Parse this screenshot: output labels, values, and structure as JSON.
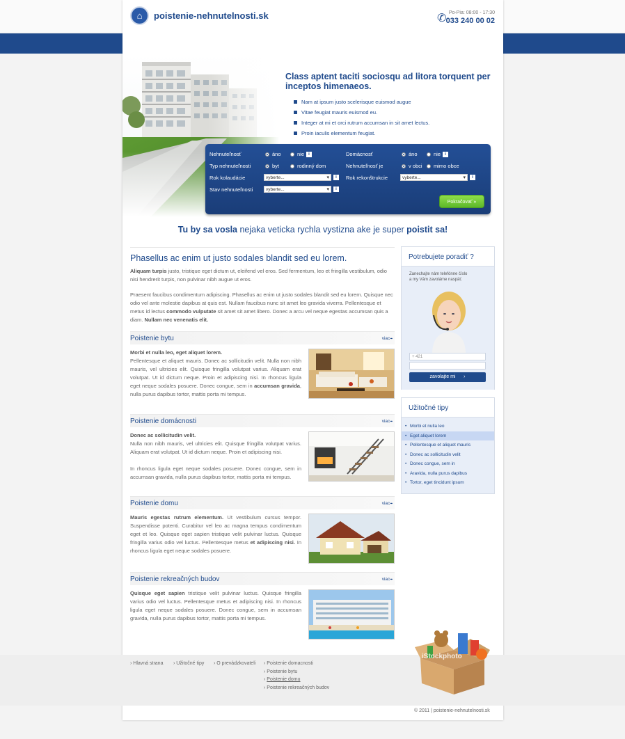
{
  "header": {
    "logo_text": "poistenie-nehnutelnosti.sk",
    "hours": "Po-Pia: 08:00 - 17:30",
    "phone": "033 240 00 02"
  },
  "nav": [
    "Hlavná strana",
    "Poistenie domacnosti",
    "Poistenie bytu",
    "Poistenie domu",
    "Poistenie rekreačných budov",
    "Užitočné tipy",
    "O prevádzkovateli"
  ],
  "hero": {
    "title": "Class aptent taciti sociosqu ad litora torquent per inceptos himenaeos.",
    "bullets": [
      "Nam at ipsum justo scelerisque euismod augue",
      "Vitae feugiat mauris euismod eu.",
      "Integer at mi et orci rutrum accumsan in sit amet lectus.",
      "Proin iaculis elementum feugiat."
    ]
  },
  "form": {
    "l1": "Nehnuteľnosť",
    "l1a": "áno",
    "l1b": "nie",
    "l2": "Typ nehnuteľnosti",
    "l2a": "byt",
    "l2b": "rodinný dom",
    "l3": "Rok kolaudácie",
    "l4": "Stav nehnuteľnosti",
    "r1": "Domácnosť",
    "r1a": "áno",
    "r1b": "nie",
    "r2": "Nehnuteľnosť je",
    "r2a": "v obci",
    "r2b": "mimo obce",
    "r3": "Rok rekonštrukcie",
    "select_value": "vyberte...",
    "info": "i",
    "submit": "Pokračovať »"
  },
  "tagline": {
    "a": "Tu by sa vosla",
    "b": " nejaka veticka rychla vystizna ake je super ",
    "c": "poistit sa!"
  },
  "intro": {
    "title": "Phasellus ac enim ut justo sodales blandit sed eu lorem.",
    "p1b": "Aliquam turpis",
    "p1": " justo, tristique eget dictum ut, eleifend vel eros. Sed fermentum, leo et fringilla vestibulum, odio nisi hendrerit turpis, non pulvinar nibh augue ut eros.",
    "p2": "Praesent faucibus condimentum adipiscing. Phasellus ac enim ut justo sodales blandit sed eu lorem. Quisque nec odio vel ante molestie dapibus at quis est. Nullam faucibus nunc sit amet leo gravida viverra. Pellentesque et metus id lectus ",
    "p2b": "commodo vulputate",
    "p2c": " sit amet sit amet libero. Donec a arcu vel neque egestas accumsan quis a diam. ",
    "p2d": "Nullam nec venenatis elit."
  },
  "more": "viac",
  "sections": [
    {
      "title": "Poistenie bytu",
      "b1": "Morbi et nulla leo, eget aliquet lorem.",
      "t1": "Pellentesque et aliquet mauris. Donec ac sollicitudin velit. Nulla non nibh mauris, vel ultricies elit. Quisque fringilla volutpat varius. Aliquam erat volutpat. Ut id dictum neque. Proin et adipiscing nisi. In rhoncus ligula eget neque sodales posuere. Donec congue, sem in ",
      "b2": "accumsan gravida",
      "t2": ", nulla purus dapibus tortor, mattis porta mi tempus."
    },
    {
      "title": "Poistenie domácnosti",
      "b1": "Donec ac sollicitudin velit.",
      "t1": "Nulla non nibh mauris, vel ultricies elit. Quisque fringilla volutpat varius. Aliquam erat volutpat. Ut id dictum neque. Proin et adipiscing nisi.",
      "t2": "In rhoncus ligula eget neque sodales posuere. Donec congue, sem in accumsan gravida, nulla purus dapibus tortor, mattis porta mi tempus."
    },
    {
      "title": "Poistenie domu",
      "b1": "Mauris egestas rutrum elementum.",
      "t1": " Ut vestibulum cursus tempor. Suspendisse potenti. Curabitur vel leo ac magna tempus condimentum eget et leo. Quisque eget sapien tristique velit pulvinar luctus. Quisque fringilla varius odio vel luctus. Pellentesque metus ",
      "b2": "et adipiscing nisi.",
      "t2": " In rhoncus ligula eget neque sodales posuere."
    },
    {
      "title": "Poistenie rekreačných budov",
      "b1": "Quisque eget sapien",
      "t1": " tristique velit pulvinar luctus. Quisque fringilla varius odio vel luctus. Pellentesque metus et adipiscing nisi. In rhoncus ligula eget neque sodales posuere. Donec congue, sem in accumsan gravida, nulla purus dapibus tortor, mattis porta mi tempus."
    }
  ],
  "callbox": {
    "title": "Potrebujete poradiť ?",
    "text": "Zanechajte nám telefónne číslo a my Vám zavoláme naspäť.",
    "phone_placeholder": "+ 421",
    "button": "zavolajte  mi"
  },
  "tips": {
    "title": "Užitočné tipy",
    "items": [
      "Morbi et nulla leo",
      "Eget aliquet lorem",
      "Pellentesque et aliquet mauris",
      "Donec ac sollicitudin velit",
      "Donec congue, sem in",
      "Aravida, nulla purus dapibus",
      "Tortor, eget tincidunt ipsum"
    ]
  },
  "footer": {
    "col1": "Hlavná strana",
    "col2": "Užitočné tipy",
    "col3": "O prevádzkovateli",
    "col4": [
      "Poistenie domacnosti",
      "Poistenie bytu",
      "Poistenie domu",
      "Poistenie rekreačných budov"
    ],
    "copyright": "©  2011   |   poistenie-nehnutelnosti.sk",
    "watermark": "iStockphoto"
  },
  "colors": {
    "brand": "#1f4a8c",
    "accent": "#6cc832"
  }
}
